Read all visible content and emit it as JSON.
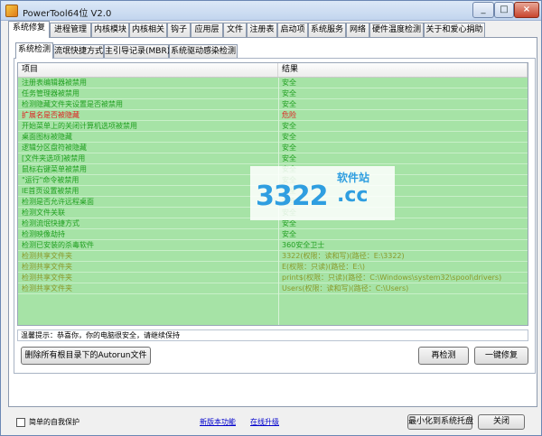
{
  "window": {
    "title": "PowerTool64位 V2.0",
    "controls": [
      "_",
      "□",
      "×"
    ]
  },
  "main_tabs": [
    {
      "label": "系统修复",
      "active": true
    },
    {
      "label": "进程管理",
      "active": false
    },
    {
      "label": "内核模块",
      "active": false
    },
    {
      "label": "内核相关",
      "active": false
    },
    {
      "label": "钩子",
      "active": false
    },
    {
      "label": "应用层",
      "active": false
    },
    {
      "label": "文件",
      "active": false
    },
    {
      "label": "注册表",
      "active": false
    },
    {
      "label": "启动项",
      "active": false
    },
    {
      "label": "系统服务",
      "active": false
    },
    {
      "label": "网络",
      "active": false
    },
    {
      "label": "硬件温度检测",
      "active": false
    },
    {
      "label": "关于和爱心捐助",
      "active": false
    }
  ],
  "sub_tabs": [
    {
      "label": "系统检测",
      "active": true
    },
    {
      "label": "流氓快捷方式",
      "active": false
    },
    {
      "label": "主引导记录(MBR)",
      "active": false
    },
    {
      "label": "系统驱动感染检测",
      "active": false
    }
  ],
  "list": {
    "columns": [
      "项目",
      "结果"
    ],
    "rows": [
      {
        "item": "注册表编辑器被禁用",
        "result": "安全",
        "color": "#22a022"
      },
      {
        "item": "任务管理器被禁用",
        "result": "安全",
        "color": "#22a022"
      },
      {
        "item": "检测隐藏文件夹设置是否被禁用",
        "result": "安全",
        "color": "#22a022"
      },
      {
        "item": "扩展名是否被隐藏",
        "result": "危险",
        "color": "#e02020"
      },
      {
        "item": "开始菜单上的关闭计算机选项被禁用",
        "result": "安全",
        "color": "#22a022"
      },
      {
        "item": "桌面图标被隐藏",
        "result": "安全",
        "color": "#22a022"
      },
      {
        "item": "逻辑分区盘符被隐藏",
        "result": "安全",
        "color": "#22a022"
      },
      {
        "item": "[文件夹选项]被禁用",
        "result": "安全",
        "color": "#22a022"
      },
      {
        "item": "鼠标右键菜单被禁用",
        "result": "安全",
        "color": "#22a022"
      },
      {
        "item": "\"运行\"命令被禁用",
        "result": "安全",
        "color": "#22a022"
      },
      {
        "item": "IE首页设置被禁用",
        "result": "安全",
        "color": "#22a022"
      },
      {
        "item": "检测是否允许远程桌面",
        "result": "安全",
        "color": "#22a022"
      },
      {
        "item": "检测文件关联",
        "result": "安全",
        "color": "#22a022"
      },
      {
        "item": "检测流氓快捷方式",
        "result": "安全",
        "color": "#22a022"
      },
      {
        "item": "检测映像劫持",
        "result": "安全",
        "color": "#22a022"
      },
      {
        "item": "检测已安装的杀毒软件",
        "result": "360安全卫士",
        "color": "#22a022"
      },
      {
        "item": "检测共享文件夹",
        "result": "3322(权限：读和写)(路径：E:\\3322)",
        "color": "#8a9a2a"
      },
      {
        "item": "检测共享文件夹",
        "result": "E(权限：只读)(路径：E:\\)",
        "color": "#8a9a2a"
      },
      {
        "item": "检测共享文件夹",
        "result": "print$(权限：只读)(路径：C:\\Windows\\system32\\spool\\drivers)",
        "color": "#8a9a2a"
      },
      {
        "item": "检测共享文件夹",
        "result": "Users(权限：读和写)(路径：C:\\Users)",
        "color": "#8a9a2a"
      }
    ]
  },
  "watermark": {
    "digits": "3322",
    "cc": ".cc",
    "site": "软件站"
  },
  "tip": "温馨提示：恭喜你，你的电脑很安全，请继续保持",
  "buttons": {
    "delete_autorun": "删除所有根目录下的Autorun文件",
    "rescan": "再检测",
    "fix": "一键修复",
    "minimize_tray": "最小化到系统托盘",
    "close": "关闭"
  },
  "self_protect": {
    "label": "简单的自我保护",
    "checked": false
  },
  "links": {
    "new_features": "新版本功能",
    "online_update": "在线升级"
  }
}
